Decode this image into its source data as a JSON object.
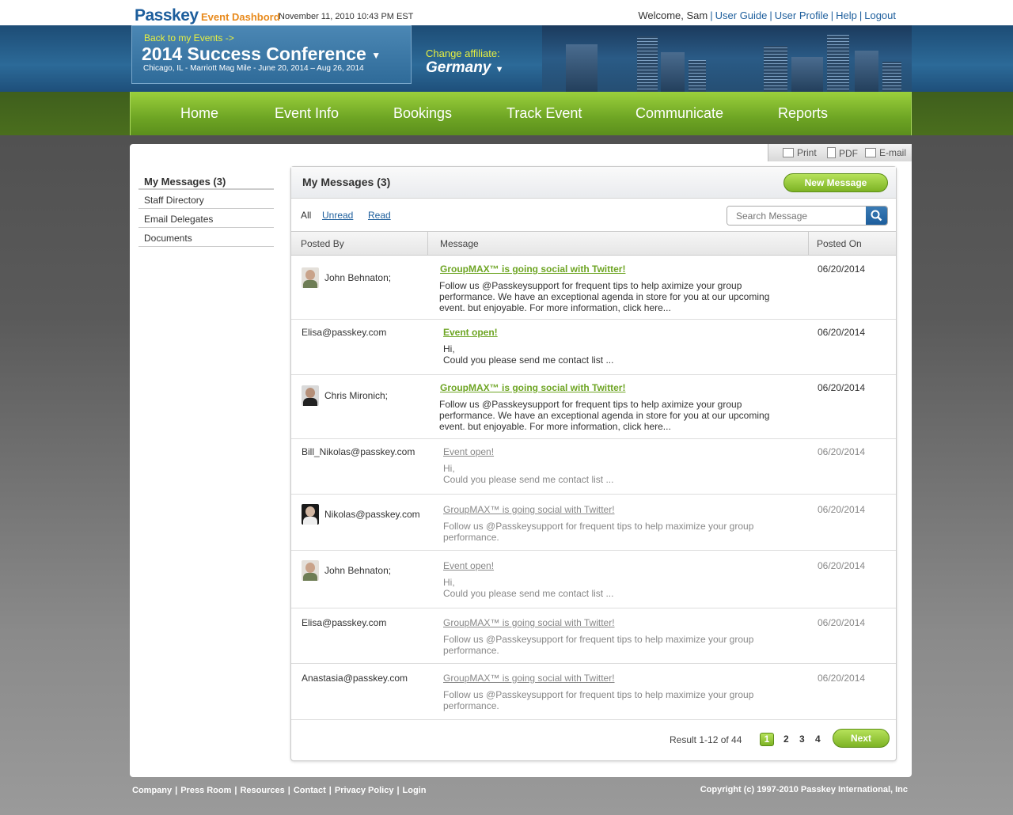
{
  "header": {
    "logo": "Passkey",
    "logo_sub": "Event Dashbord",
    "datetime": "November 11, 2010 10:43 PM EST",
    "welcome": "Welcome, Sam",
    "links": [
      "User Guide",
      "User Profile",
      "Help",
      "Logout"
    ]
  },
  "event": {
    "back_label": "Back to my Events ->",
    "title": "2014 Success Conference",
    "subtitle": "Chicago, IL  - Marriott Mag Mile - June 20, 2014 – Aug 26, 2014",
    "affiliate_label": "Change  affiliate:",
    "affiliate_value": "Germany"
  },
  "nav": [
    "Home",
    "Event Info",
    "Bookings",
    "Track Event",
    "Communicate",
    "Reports"
  ],
  "tools": [
    "Print",
    "PDF",
    "E-mail"
  ],
  "sidebar": [
    "My Messages (3)",
    "Staff Directory",
    "Email Delegates",
    "Documents"
  ],
  "panel": {
    "title": "My Messages (3)",
    "new_button": "New Message",
    "filters": [
      "All",
      "Unread",
      "Read"
    ],
    "search_placeholder": "Search Message",
    "columns": [
      "Posted By",
      "Message",
      "Posted On"
    ]
  },
  "messages": [
    {
      "poster": "John Behnaton;",
      "subject": "GroupMAX™ is going social with Twitter!",
      "body": [
        "Follow us @Passkeysupport for frequent tips to help aximize your group",
        "performance. We have an exceptional agenda in store for you at our upcoming",
        "event.  but enjoyable.  For more information, click here..."
      ],
      "date": "06/20/2014"
    },
    {
      "poster": "Elisa@passkey.com",
      "subject": "Event open!",
      "body": [
        "Hi,",
        "Could you please send me contact list ..."
      ],
      "date": "06/20/2014"
    },
    {
      "poster": "Chris Mironich;",
      "subject": "GroupMAX™ is going social with Twitter!",
      "body": [
        "Follow us @Passkeysupport for frequent tips to help aximize your group",
        "performance. We have an exceptional agenda in store for you at our upcoming",
        "event.  but enjoyable.  For more information, click here..."
      ],
      "date": "06/20/2014"
    },
    {
      "poster": "Bill_Nikolas@passkey.com",
      "subject": "Event open!",
      "body": [
        "Hi,",
        "Could you please send me contact list ..."
      ],
      "date": "06/20/2014"
    },
    {
      "poster": "Nikolas@passkey.com",
      "subject": "GroupMAX™ is going social with Twitter!",
      "body": [
        "Follow us @Passkeysupport for frequent tips to help maximize your group",
        "performance."
      ],
      "date": "06/20/2014"
    },
    {
      "poster": "John Behnaton;",
      "subject": "Event open!",
      "body": [
        "Hi,",
        "Could you please send me contact list ..."
      ],
      "date": "06/20/2014"
    },
    {
      "poster": "Elisa@passkey.com",
      "subject": "GroupMAX™ is going social with Twitter!",
      "body": [
        "Follow us @Passkeysupport for frequent tips to help maximize your group",
        "performance."
      ],
      "date": "06/20/2014"
    },
    {
      "poster": "Anastasia@passkey.com",
      "subject": "GroupMAX™ is going social with Twitter!",
      "body": [
        "Follow us @Passkeysupport for frequent tips to help maximize your group",
        "performance."
      ],
      "date": "06/20/2014"
    }
  ],
  "pager": {
    "result": "Result 1-12 of 44",
    "pages": [
      "1",
      "2",
      "3",
      "4"
    ],
    "next": "Next"
  },
  "footer": {
    "links": [
      "Company",
      "Press Room",
      "Resources",
      "Contact",
      "Privacy Policy",
      "Login"
    ],
    "copyright": "Copyright (c) 1997-2010 Passkey International, Inc"
  },
  "colors": {
    "brand_blue": "#1d5e9c",
    "brand_orange": "#e88a1c",
    "accent_green": "#6ea524",
    "highlight_yellow": "#e7f040"
  }
}
